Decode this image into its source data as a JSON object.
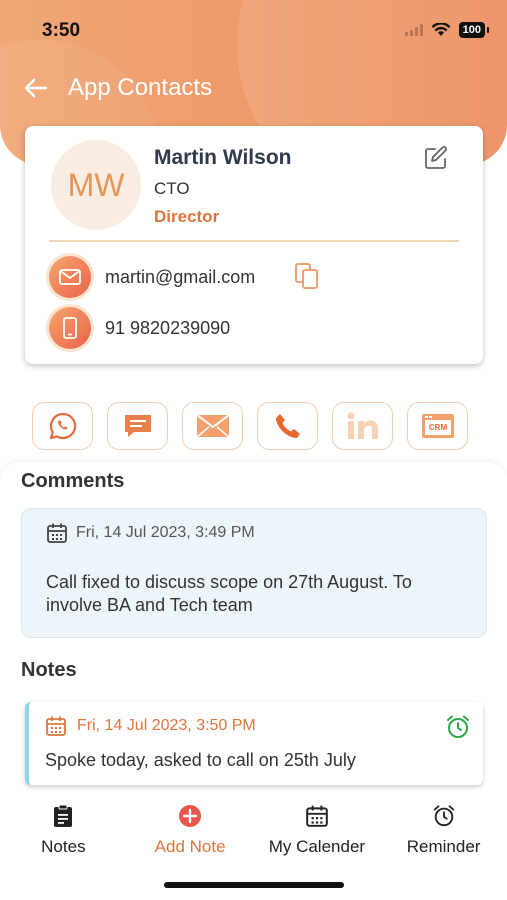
{
  "status_bar": {
    "time": "3:50",
    "battery": "100"
  },
  "header": {
    "title": "App Contacts",
    "back_icon": "arrow-left-icon"
  },
  "contact": {
    "initials": "MW",
    "name": "Martin Wilson",
    "role": "CTO",
    "designation": "Director",
    "email": "martin@gmail.com",
    "phone": "91 9820239090"
  },
  "actions": [
    {
      "name": "whatsapp-icon"
    },
    {
      "name": "sms-icon"
    },
    {
      "name": "email-icon"
    },
    {
      "name": "phone-icon"
    },
    {
      "name": "linkedin-icon"
    },
    {
      "name": "crm-icon"
    }
  ],
  "comments": {
    "title": "Comments",
    "items": [
      {
        "date": "Fri, 14 Jul 2023, 3:49 PM",
        "text": "Call fixed to discuss scope on 27th August. To involve BA and Tech team"
      }
    ]
  },
  "notes": {
    "title": "Notes",
    "items": [
      {
        "date": "Fri, 14 Jul 2023, 3:50 PM",
        "text": "Spoke today, asked to call on 25th July"
      }
    ]
  },
  "tabs": [
    {
      "label": "Notes",
      "icon": "clipboard-icon",
      "active": false
    },
    {
      "label": "Add Note",
      "icon": "plus-circle-icon",
      "active": true
    },
    {
      "label": "My Calender",
      "icon": "calendar-icon",
      "active": false
    },
    {
      "label": "Reminder",
      "icon": "alarm-icon",
      "active": false
    }
  ],
  "colors": {
    "accent": "#e0743d",
    "header_start": "#f1a877",
    "header_end": "#eb8758",
    "comment_bg": "#edf5fb"
  }
}
